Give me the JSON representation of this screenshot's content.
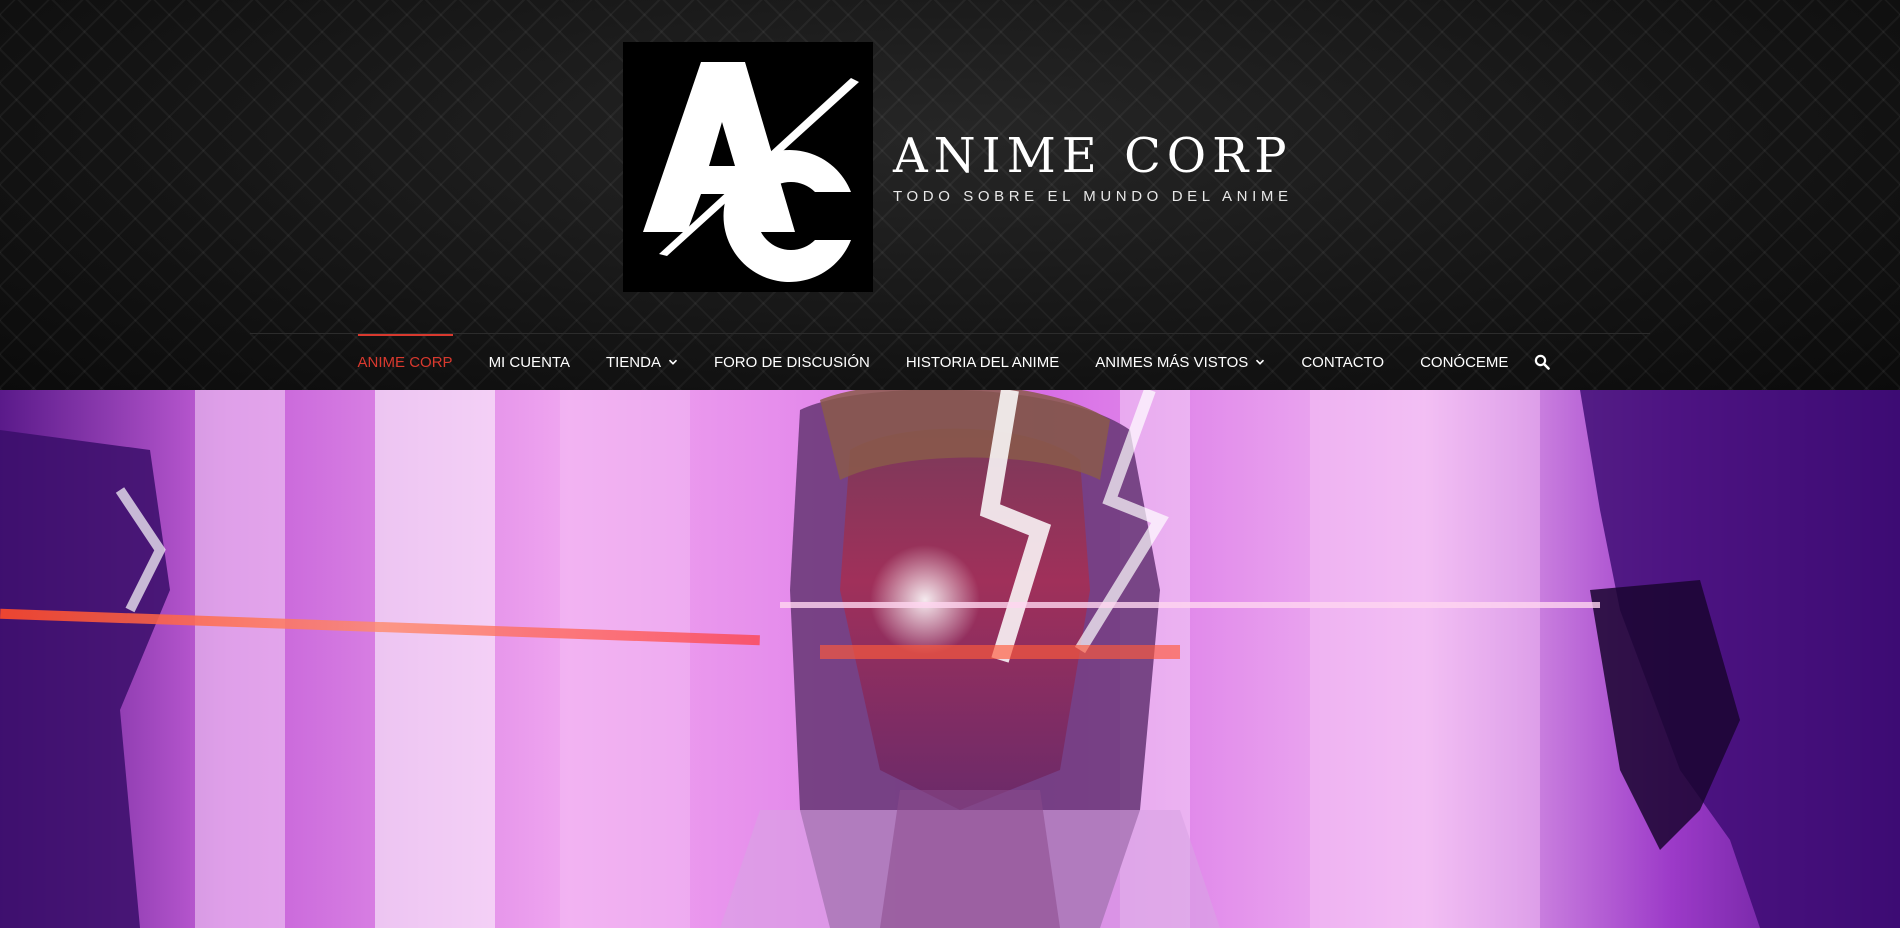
{
  "site": {
    "logo_text": "AC",
    "title": "ANIME CORP",
    "tagline": "TODO SOBRE EL MUNDO DEL ANIME"
  },
  "nav": {
    "items": [
      {
        "label": "ANIME CORP",
        "active": true,
        "has_dropdown": false
      },
      {
        "label": "MI CUENTA",
        "active": false,
        "has_dropdown": false
      },
      {
        "label": "TIENDA",
        "active": false,
        "has_dropdown": true
      },
      {
        "label": "FORO DE DISCUSIÓN",
        "active": false,
        "has_dropdown": false
      },
      {
        "label": "HISTORIA DEL ANIME",
        "active": false,
        "has_dropdown": false
      },
      {
        "label": "ANIMES MÁS VISTOS",
        "active": false,
        "has_dropdown": true
      },
      {
        "label": "CONTACTO",
        "active": false,
        "has_dropdown": false
      },
      {
        "label": "CONÓCEME",
        "active": false,
        "has_dropdown": false
      }
    ],
    "search_icon": "search-icon",
    "dropdown_icon": "chevron-down-icon"
  },
  "colors": {
    "accent": "#d9392e",
    "header_bg": "#141414",
    "hero_magenta": "#e070e8",
    "hero_purple": "#6a1aa8"
  }
}
